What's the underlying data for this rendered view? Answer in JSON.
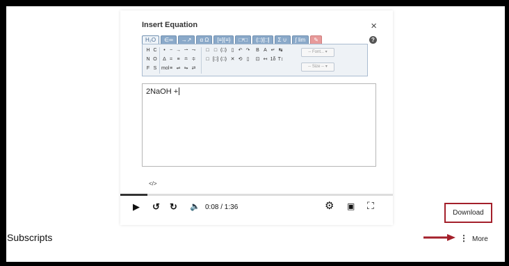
{
  "dialog": {
    "title": "Insert Equation",
    "close_glyph": "×",
    "help_glyph": "?",
    "tabs": [
      "H₂O",
      "∈∞",
      "→↗",
      "α Ω",
      "[≡]{≡}",
      "□ᵃ□",
      "(□)[□]",
      "Σ ∪",
      "∫ lim",
      "✎"
    ],
    "toolbar": {
      "group1": [
        "H",
        "C",
        "N",
        "O",
        "F",
        "S"
      ],
      "group2": [
        "•",
        "−",
        "→",
        "⇀",
        "⇁",
        "Δ",
        "=",
        "≡",
        "≐",
        "≑",
        "mol",
        "≡",
        "⇌",
        "⇋",
        "⇄"
      ],
      "group3": [
        "□",
        "□",
        "(□)",
        "□",
        "[□]",
        "(□)"
      ],
      "group4": [
        "▯",
        "↶",
        "↷",
        "✕",
        "⟲",
        "▯"
      ],
      "group5": [
        "B",
        "A",
        "↵",
        "↹",
        "⊡",
        "↤",
        "1δ",
        "T↕"
      ],
      "font_placeholder": "-- Font... ▾",
      "size_placeholder": "-- Size -- ▾"
    },
    "editor_text": "2NaOH +",
    "code_icon": "</>"
  },
  "player": {
    "time": "0:08 / 1:36",
    "progress": 0.1,
    "play_glyph": "▶",
    "rewind_glyph": "↺",
    "forward_glyph": "↻",
    "volume_glyph": "🔈",
    "settings_glyph": "⚙",
    "pip_glyph": "▣",
    "fullscreen_glyph": "⛶"
  },
  "page": {
    "download_label": "Download",
    "section_title": "Subscripts",
    "more_label": "More",
    "more_glyph": "⋮"
  },
  "colors": {
    "highlight": "#a31f2a",
    "arrow": "#a31f2a"
  }
}
